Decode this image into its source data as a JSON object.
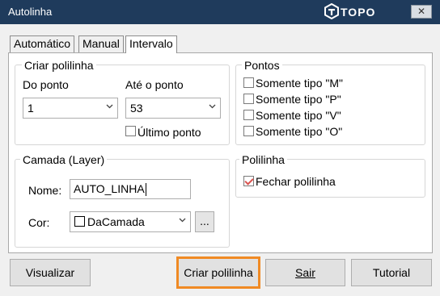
{
  "window": {
    "title": "Autolinha",
    "brand": "TOPO",
    "close_label": "✕"
  },
  "tabs": [
    {
      "label": "Automático",
      "active": false
    },
    {
      "label": "Manual",
      "active": false
    },
    {
      "label": "Intervalo",
      "active": true
    }
  ],
  "criar_polilinha": {
    "legend": "Criar polilinha",
    "do_ponto_label": "Do ponto",
    "do_ponto_value": "1",
    "ate_ponto_label": "Até o ponto",
    "ate_ponto_value": "53",
    "ultimo_ponto_label": "Último ponto",
    "ultimo_ponto_checked": false
  },
  "pontos": {
    "legend": "Pontos",
    "options": [
      {
        "label": "Somente tipo \"M\"",
        "checked": false
      },
      {
        "label": "Somente tipo \"P\"",
        "checked": false
      },
      {
        "label": "Somente tipo \"V\"",
        "checked": false
      },
      {
        "label": "Somente tipo \"O\"",
        "checked": false
      }
    ]
  },
  "camada": {
    "legend": "Camada (Layer)",
    "nome_label": "Nome:",
    "nome_value": "AUTO_LINHA",
    "cor_label": "Cor:",
    "cor_value": "DaCamada",
    "cor_swatch": "#ffffff",
    "ellipsis_label": "..."
  },
  "polilinha": {
    "legend": "Polilinha",
    "fechar_label": "Fechar polilinha",
    "fechar_checked": true
  },
  "buttons": {
    "visualizar": "Visualizar",
    "criar": "Criar polilinha",
    "sair": "Sair",
    "tutorial": "Tutorial"
  },
  "colors": {
    "titlebar": "#1f3b5c",
    "highlight": "#f08a24",
    "check_mark": "#d9534f"
  }
}
